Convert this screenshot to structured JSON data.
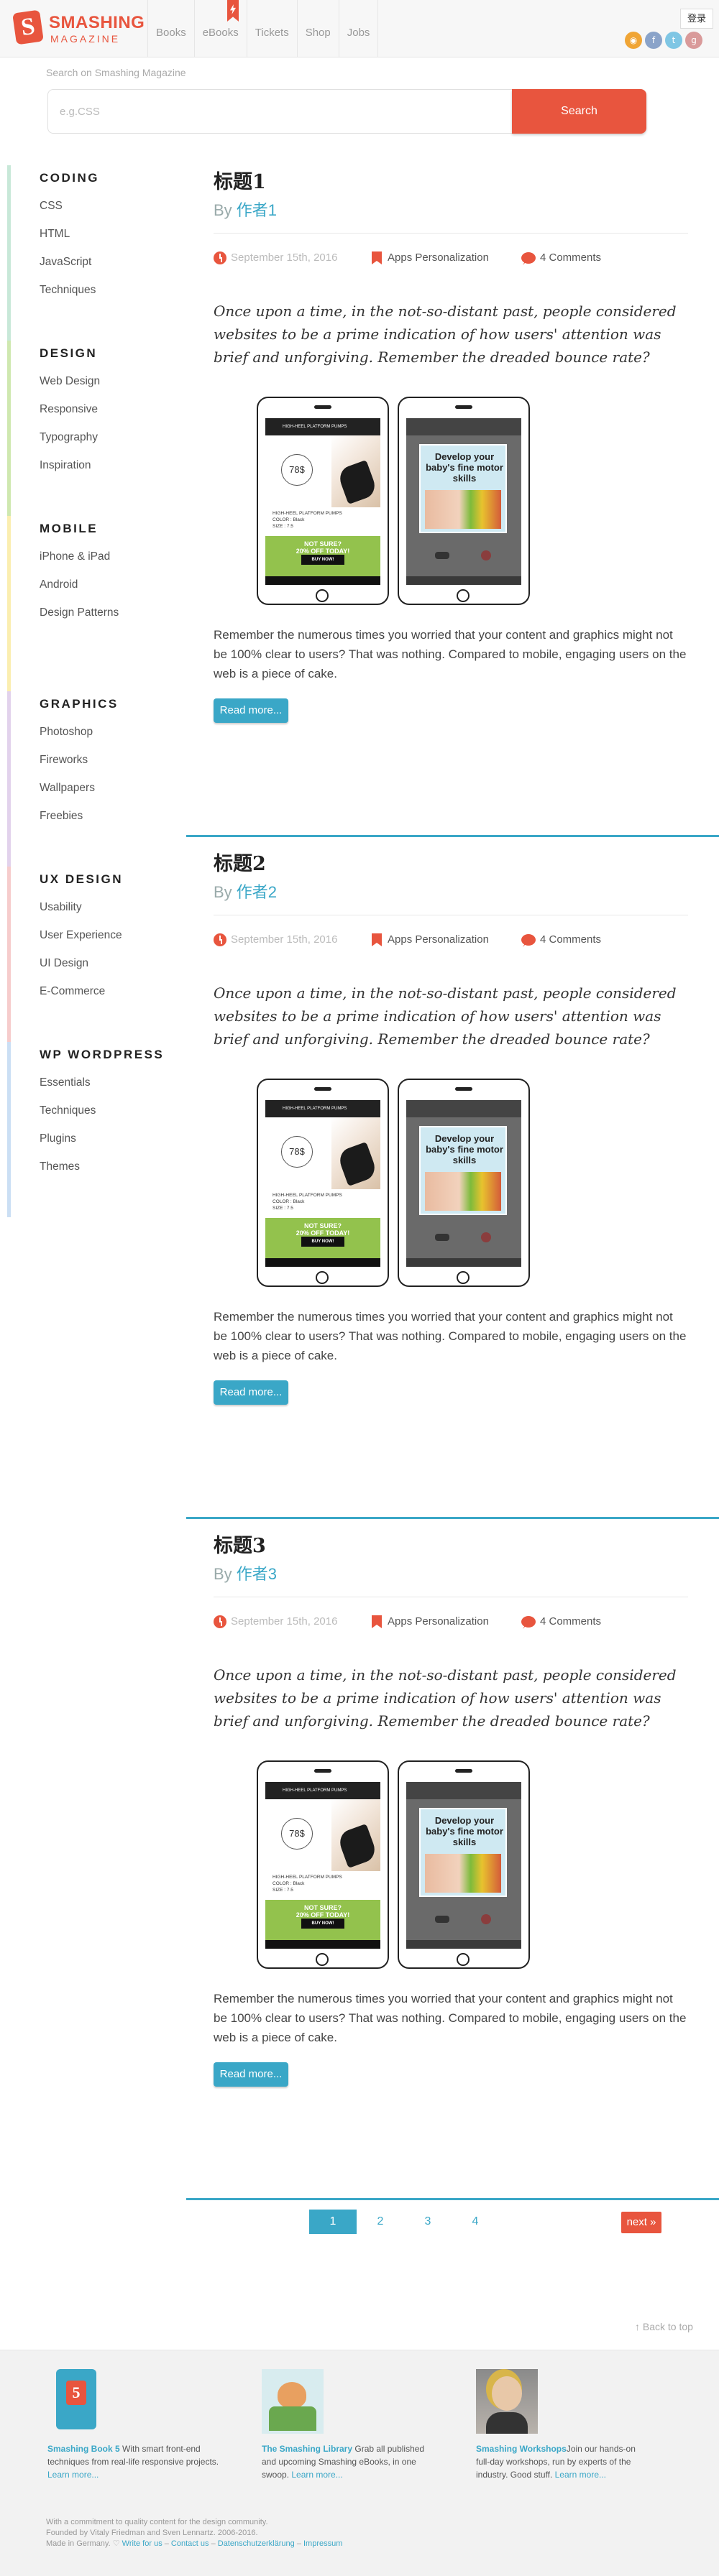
{
  "header": {
    "logo_name": "SMASHING",
    "logo_sub": "MAGAZINE",
    "nav": [
      "Books",
      "eBooks",
      "Tickets",
      "Shop",
      "Jobs"
    ],
    "login": "登录",
    "social_icons": [
      "rss-icon",
      "facebook-icon",
      "twitter-icon",
      "google-plus-icon"
    ]
  },
  "search": {
    "label": "Search on Smashing Magazine",
    "placeholder": "e.g.CSS",
    "button": "Search"
  },
  "sidebar": [
    {
      "title": "CODING",
      "color": "#c8e8d8",
      "links": [
        "CSS",
        "HTML",
        "JavaScript",
        "Techniques"
      ]
    },
    {
      "title": "DESIGN",
      "color": "#cfe8b0",
      "links": [
        "Web Design",
        "Responsive",
        "Typography",
        "Inspiration"
      ]
    },
    {
      "title": "MOBILE",
      "color": "#fbeeb0",
      "links": [
        "iPhone & iPad",
        "Android",
        "Design Patterns"
      ]
    },
    {
      "title": "GRAPHICS",
      "color": "#e2d2ec",
      "links": [
        "Photoshop",
        "Fireworks",
        "Wallpapers",
        "Freebies"
      ]
    },
    {
      "title": "UX DESIGN",
      "color": "#f6cccc",
      "links": [
        "Usability",
        "User Experience",
        "UI Design",
        "E-Commerce"
      ]
    },
    {
      "title": "WP WORDPRESS",
      "color": "#cbdff4",
      "links": [
        "Essentials",
        "Techniques",
        "Plugins",
        "Themes"
      ]
    }
  ],
  "posts": [
    {
      "title": "标题1",
      "by": "By ",
      "author": "作者1",
      "date": "September 15th, 2016",
      "tag": "Apps Personalization",
      "comments": "4 Comments",
      "intro": "Once upon a time, in the not-so-distant past, people considered websites to be a prime indication of how users' attention was brief and unforgiving. Remember the dreaded bounce rate?",
      "body": "Remember the numerous times you worried that your content and graphics might not be 100% clear to users? That was nothing. Compared to mobile, engaging users on the web is a piece of cake.",
      "read_more": "Read more..."
    },
    {
      "title": "标题2",
      "by": "By ",
      "author": "作者2",
      "date": "September 15th, 2016",
      "tag": "Apps Personalization",
      "comments": "4 Comments",
      "intro": "Once upon a time, in the not-so-distant past, people considered websites to be a prime indication of how users' attention was brief and unforgiving. Remember the dreaded bounce rate?",
      "body": "Remember the numerous times you worried that your content and graphics might not be 100% clear to users? That was nothing. Compared to mobile, engaging users on the web is a piece of cake.",
      "read_more": "Read more..."
    },
    {
      "title": "标题3",
      "by": "By ",
      "author": "作者3",
      "date": "September 15th, 2016",
      "tag": "Apps Personalization",
      "comments": "4 Comments",
      "intro": "Once upon a time, in the not-so-distant past, people considered websites to be a prime indication of how users' attention was brief and unforgiving. Remember the dreaded bounce rate?",
      "body": "Remember the numerous times you worried that your content and graphics might not be 100% clear to users? That was nothing. Compared to mobile, engaging users on the web is a piece of cake.",
      "read_more": "Read more..."
    }
  ],
  "phone_mock": {
    "left": {
      "status": "HIGH-HEEL PLATFORM PUMPS",
      "price": "78$",
      "info": [
        "HIGH-HEEL PLATFORM PUMPS",
        "COLOR : Black",
        "SIZE :  7.5"
      ],
      "promo_1": "NOT SURE?",
      "promo_2": "20% OFF TODAY!",
      "buy": "BUY NOW!"
    },
    "right": {
      "ad_text": "Develop your baby's fine motor skills"
    }
  },
  "pagination": {
    "pages": [
      "1",
      "2",
      "3",
      "4"
    ],
    "active": "1",
    "next": "next »"
  },
  "back_to_top": "↑ Back to top",
  "footer": {
    "promos": [
      {
        "highlight": "Smashing Book 5",
        "text": " With smart front-end techniques from real-life responsive projects. ",
        "more": "Learn more..."
      },
      {
        "highlight": "The Smashing Library",
        "text": " Grab all published and upcoming Smashing eBooks, in one swoop. ",
        "more": "Learn more..."
      },
      {
        "highlight": "Smashing Workshops",
        "text": "Join our hands-on full-day workshops, run by experts of the industry. Good stuff. ",
        "more": "Learn more..."
      }
    ],
    "fine": [
      "With a commitment to quality content for the design community.",
      "Founded by Vitaly Friedman and Sven Lennartz. 2006-2016.",
      "Made in Germany. ♡"
    ],
    "links": [
      "Write for us",
      "Contact us",
      "Datenschutzerklärung",
      "Impressum"
    ]
  },
  "colors": {
    "accent_red": "#e8553e",
    "accent_blue": "#3aa7c7"
  }
}
